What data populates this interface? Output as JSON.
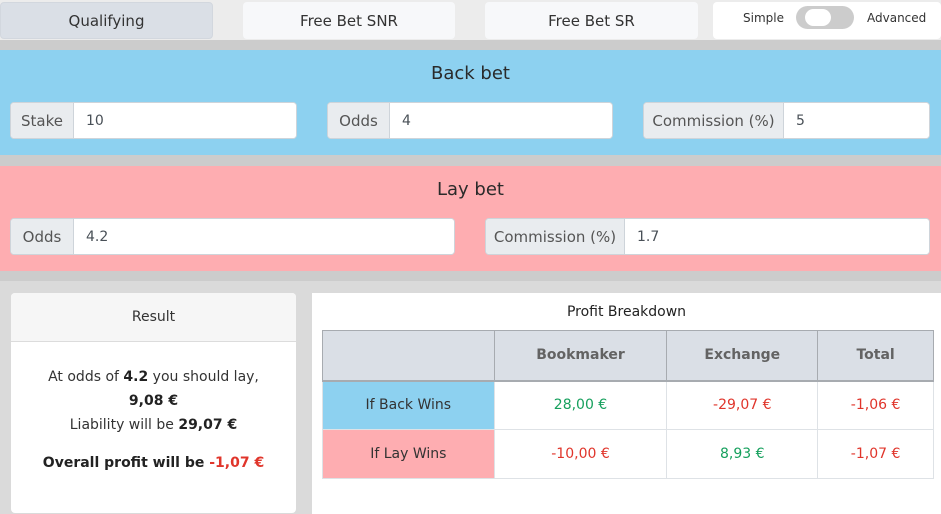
{
  "tabs": [
    {
      "label": "Qualifying",
      "active": true
    },
    {
      "label": "Free Bet SNR",
      "active": false
    },
    {
      "label": "Free Bet SR",
      "active": false
    }
  ],
  "mode_toggle": {
    "left_label": "Simple",
    "right_label": "Advanced",
    "selected": "Simple"
  },
  "back_bet": {
    "title": "Back bet",
    "color": "#8dd1f0",
    "fields": {
      "stake": {
        "label": "Stake",
        "value": "10"
      },
      "odds": {
        "label": "Odds",
        "value": "4"
      },
      "commission": {
        "label": "Commission (%)",
        "value": "5"
      }
    }
  },
  "lay_bet": {
    "title": "Lay bet",
    "color": "#feadb1",
    "fields": {
      "odds": {
        "label": "Odds",
        "value": "4.2"
      },
      "commission": {
        "label": "Commission (%)",
        "value": "1.7"
      }
    }
  },
  "result": {
    "title": "Result",
    "line1_prefix": "At odds of ",
    "lay_odds": "4.2",
    "line1_suffix": " you should lay,",
    "lay_stake": "9,08 €",
    "liability_prefix": "Liability will be ",
    "liability": "29,07 €",
    "overall_prefix": "Overall profit will be ",
    "overall_profit": "-1,07 €"
  },
  "profit_breakdown": {
    "title": "Profit Breakdown",
    "columns": [
      "",
      "Bookmaker",
      "Exchange",
      "Total"
    ],
    "rows": [
      {
        "label": "If Back Wins",
        "bookmaker": "28,00 €",
        "exchange": "-29,07 €",
        "total": "-1,06 €"
      },
      {
        "label": "If Lay Wins",
        "bookmaker": "-10,00 €",
        "exchange": "8,93 €",
        "total": "-1,07 €"
      }
    ]
  },
  "colors": {
    "positive": "#16a05d",
    "negative": "#e0352b"
  }
}
